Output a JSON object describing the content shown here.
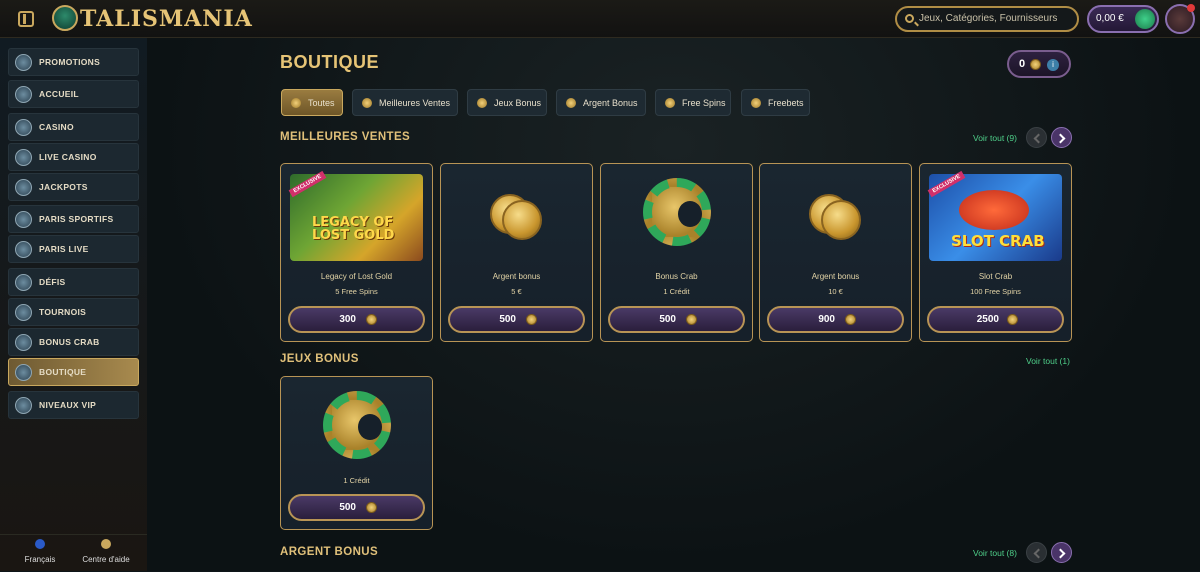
{
  "header": {
    "brand": "TALISMANIA",
    "search_placeholder": "Jeux, Catégories, Fournisseurs",
    "balance": "0,00 €"
  },
  "sidebar": {
    "items": [
      {
        "label": "PROMOTIONS",
        "icon": "promotions-icon"
      },
      {
        "label": "ACCUEIL",
        "icon": "home-icon"
      },
      {
        "label": "CASINO",
        "icon": "casino-chip-icon"
      },
      {
        "label": "LIVE CASINO",
        "icon": "cards-icon"
      },
      {
        "label": "JACKPOTS",
        "icon": "jackpot-icon"
      },
      {
        "label": "PARIS SPORTIFS",
        "icon": "soccer-ball-icon"
      },
      {
        "label": "PARIS LIVE",
        "icon": "live-tv-icon"
      },
      {
        "label": "DÉFIS",
        "icon": "challenge-icon"
      },
      {
        "label": "TOURNOIS",
        "icon": "trophy-icon"
      },
      {
        "label": "BONUS CRAB",
        "icon": "crab-icon"
      },
      {
        "label": "BOUTIQUE",
        "icon": "shop-icon",
        "active": true
      },
      {
        "label": "NIVEAUX VIP",
        "icon": "diamond-icon"
      }
    ],
    "footer": {
      "language": "Français",
      "help": "Centre d'aide"
    }
  },
  "page": {
    "title": "BOUTIQUE",
    "points": "0",
    "tabs": [
      {
        "label": "Toutes",
        "active": true
      },
      {
        "label": "Meilleures Ventes"
      },
      {
        "label": "Jeux Bonus"
      },
      {
        "label": "Argent Bonus"
      },
      {
        "label": "Free Spins"
      },
      {
        "label": "Freebets"
      }
    ]
  },
  "sections": {
    "best": {
      "title": "MEILLEURES VENTES",
      "see_all": "Voir tout (9)",
      "cards": [
        {
          "name": "Legacy of Lost Gold",
          "sub": "5 Free Spins",
          "price": "300",
          "image_text": "LEGACY OF LOST GOLD",
          "badge": "EXCLUSIVE"
        },
        {
          "name": "Argent bonus",
          "sub": "5 €",
          "price": "500"
        },
        {
          "name": "Bonus Crab",
          "sub": "1 Crédit",
          "price": "500"
        },
        {
          "name": "Argent bonus",
          "sub": "10 €",
          "price": "900"
        },
        {
          "name": "Slot Crab",
          "sub": "100 Free Spins",
          "price": "2500",
          "image_text": "SLOT CRAB",
          "badge": "EXCLUSIVE"
        }
      ]
    },
    "games": {
      "title": "JEUX BONUS",
      "see_all": "Voir tout (1)",
      "cards": [
        {
          "name": "",
          "sub": "1 Crédit",
          "price": "500"
        }
      ]
    },
    "money": {
      "title": "ARGENT BONUS",
      "see_all": "Voir tout (8)"
    }
  }
}
